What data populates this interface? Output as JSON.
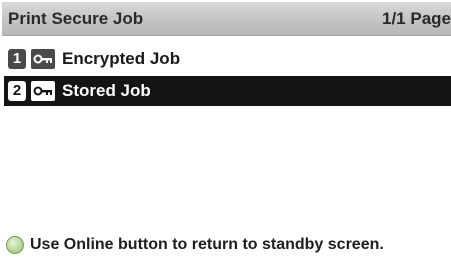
{
  "header": {
    "title": "Print Secure Job",
    "page_indicator": "1/1 Page"
  },
  "jobs": [
    {
      "number": "1",
      "icon": "key-icon",
      "label": "Encrypted Job",
      "selected": false
    },
    {
      "number": "2",
      "icon": "key-icon",
      "label": "Stored Job",
      "selected": true
    }
  ],
  "status": {
    "icon": "online-led-icon",
    "message": "Use Online button to return to standby screen."
  },
  "colors": {
    "title_bar": "#c4c4c4",
    "selected_row": "#141414",
    "online_led": "#b9d79a"
  }
}
